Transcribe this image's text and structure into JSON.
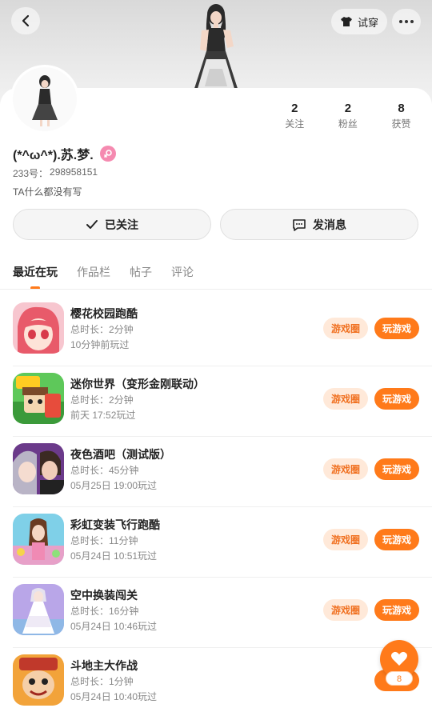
{
  "header": {
    "tryon_label": "试穿"
  },
  "profile": {
    "nickname": "(*^ω^*).苏.梦.",
    "uid_label": "233号：",
    "uid_value": "298958151",
    "bio": "TA什么都没有写",
    "stats": [
      {
        "value": "2",
        "label": "关注"
      },
      {
        "value": "2",
        "label": "粉丝"
      },
      {
        "value": "8",
        "label": "获赞"
      }
    ]
  },
  "actions": {
    "follow_label": "已关注",
    "message_label": "发消息"
  },
  "tabs": [
    "最近在玩",
    "作品栏",
    "帖子",
    "评论"
  ],
  "games": [
    {
      "title": "樱花校园跑酷",
      "duration": "总时长：2分钟",
      "last_played": "10分钟前玩过",
      "circle_label": "游戏圈",
      "play_label": "玩游戏"
    },
    {
      "title": "迷你世界（变形金刚联动）",
      "duration": "总时长：2分钟",
      "last_played": "前天 17:52玩过",
      "circle_label": "游戏圈",
      "play_label": "玩游戏"
    },
    {
      "title": "夜色酒吧（测试版）",
      "duration": "总时长：45分钟",
      "last_played": "05月25日 19:00玩过",
      "circle_label": "游戏圈",
      "play_label": "玩游戏"
    },
    {
      "title": "彩虹变装飞行跑酷",
      "duration": "总时长：11分钟",
      "last_played": "05月24日 10:51玩过",
      "circle_label": "游戏圈",
      "play_label": "玩游戏"
    },
    {
      "title": "空中换装闯关",
      "duration": "总时长：16分钟",
      "last_played": "05月24日 10:46玩过",
      "circle_label": "游戏圈",
      "play_label": "玩游戏"
    },
    {
      "title": "斗地主大作战",
      "duration": "总时长：1分钟",
      "last_played": "05月24日 10:40玩过",
      "circle_label": "",
      "play_label": "玩"
    }
  ],
  "fab": {
    "count": "8"
  },
  "colors": {
    "accent": "#ff7a1a",
    "accent_soft": "#ffe9d9",
    "gender": "#f58ab0"
  }
}
